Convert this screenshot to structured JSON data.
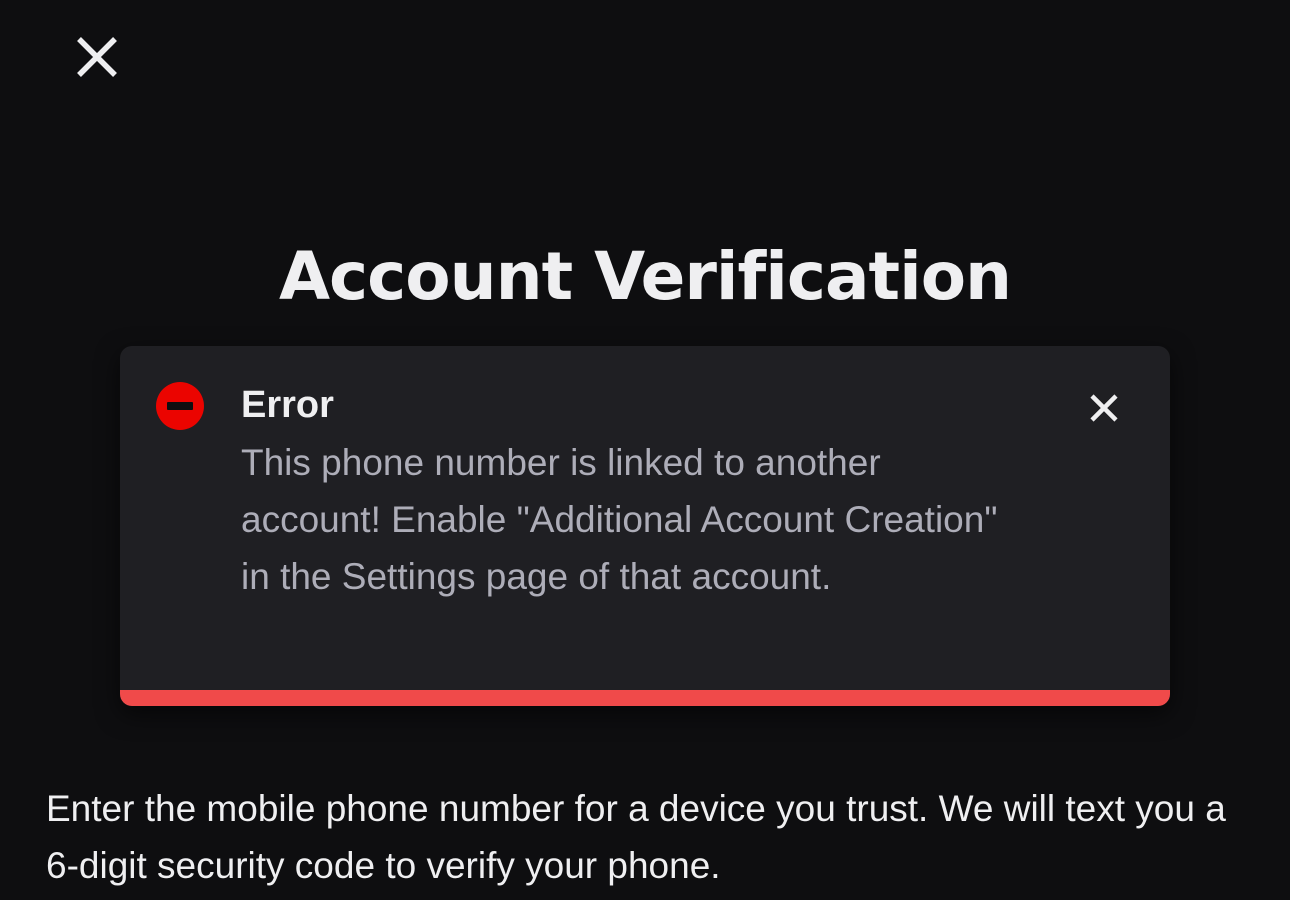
{
  "header": {
    "close_icon": "close-icon"
  },
  "page": {
    "title": "Account Verification"
  },
  "error_toast": {
    "icon": "error-minus-circle-icon",
    "heading": "Error",
    "message": "This phone number is linked to another account! Enable \"Additional Account Creation\" in the Settings page of that account.",
    "dismiss_icon": "close-icon",
    "accent_color": "#f04a4a",
    "icon_color": "#eb0400"
  },
  "instructions": {
    "text": "Enter the mobile phone number for a device you trust. We will text you a 6-digit security code to verify your phone."
  }
}
